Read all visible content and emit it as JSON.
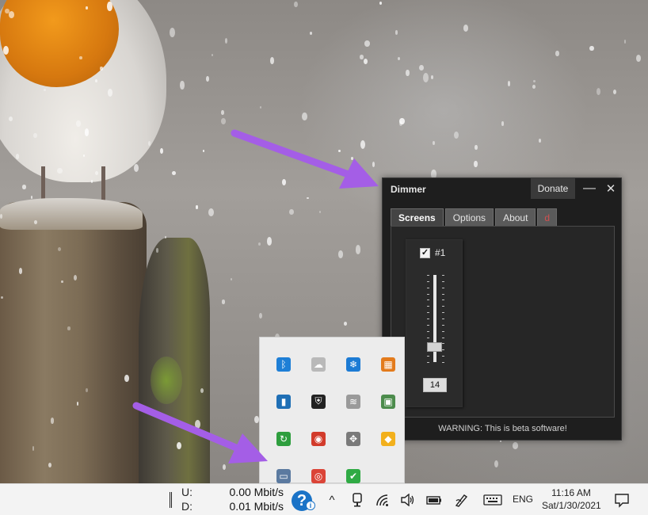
{
  "dimmer": {
    "title": "Dimmer",
    "donate_label": "Donate",
    "minimize_glyph": "—",
    "close_glyph": "✕",
    "tabs": [
      {
        "label": "Screens",
        "active": true
      },
      {
        "label": "Options",
        "active": false
      },
      {
        "label": "About",
        "active": false
      },
      {
        "label": "d",
        "active": false
      }
    ],
    "screen": {
      "checked": true,
      "label": "#1",
      "value": "14",
      "slider_fraction": 0.14
    },
    "warning": "WARNING: This is beta software!"
  },
  "tray": {
    "icons": [
      {
        "name": "bluetooth-icon",
        "color": "#1e7fd6"
      },
      {
        "name": "cloud-sync-icon",
        "color": "#b9b9b9"
      },
      {
        "name": "snowflake-app-icon",
        "color": "#1c7bd4"
      },
      {
        "name": "tiles-app-icon",
        "color": "#e37b1c"
      },
      {
        "name": "onedrive-app-icon",
        "color": "#1f6fb5"
      },
      {
        "name": "windows-security-icon",
        "color": "#222222"
      },
      {
        "name": "wifi-icon",
        "color": "#9a9a9a"
      },
      {
        "name": "network-drive-icon",
        "color": "#4c8c4c"
      },
      {
        "name": "sync-tool-icon",
        "color": "#2e9e3e"
      },
      {
        "name": "vpn-shield-icon",
        "color": "#d23b2b"
      },
      {
        "name": "puzzle-app-icon",
        "color": "#7a7a7a"
      },
      {
        "name": "norton-shield-icon",
        "color": "#f2b01c"
      },
      {
        "name": "dimmer-tray-icon",
        "color": "#5b7aa0"
      },
      {
        "name": "chrome-icon",
        "color": "#db4437"
      },
      {
        "name": "checkmark-app-icon",
        "color": "#2faa44"
      }
    ]
  },
  "taskbar": {
    "upload_label": "U:",
    "download_label": "D:",
    "upload_speed": "0.00 Mbit/s",
    "download_speed": "0.01 Mbit/s",
    "help_glyph": "?",
    "help_badge": "i",
    "chevron_glyph": "^",
    "language": "ENG",
    "time": "11:16 AM",
    "date": "Sat/1/30/2021"
  },
  "colors": {
    "accent_arrow": "#a45ee6",
    "dimmer_bg": "#1e1e1e"
  }
}
